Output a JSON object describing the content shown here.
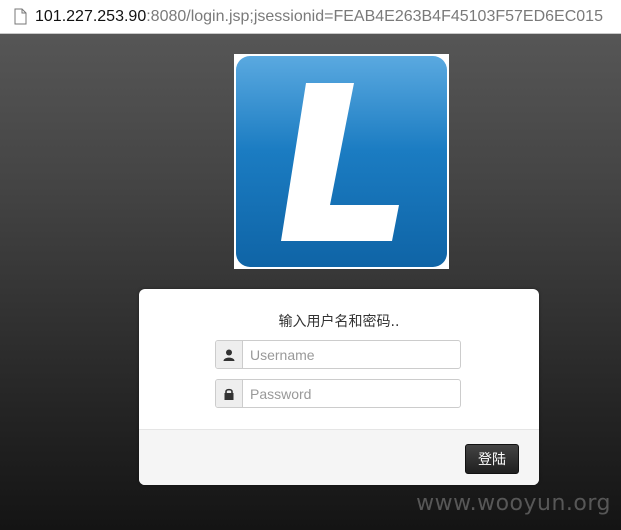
{
  "address_bar": {
    "url_host": "101.227.253.90",
    "url_rest": ":8080/login.jsp;jsessionid=FEAB4E263B4F45103F57ED6EC015",
    "page_icon": "page-icon"
  },
  "logo": {
    "letter": "L",
    "colors": {
      "blue": "#1773b8",
      "light": "#5aa9e0"
    }
  },
  "login": {
    "prompt": "输入用户名和密码..",
    "username_placeholder": "Username",
    "username_value": "",
    "username_icon": "user-icon",
    "password_placeholder": "Password",
    "password_value": "",
    "password_icon": "lock-icon",
    "submit_label": "登陆"
  },
  "watermark": "www.wooyun.org"
}
